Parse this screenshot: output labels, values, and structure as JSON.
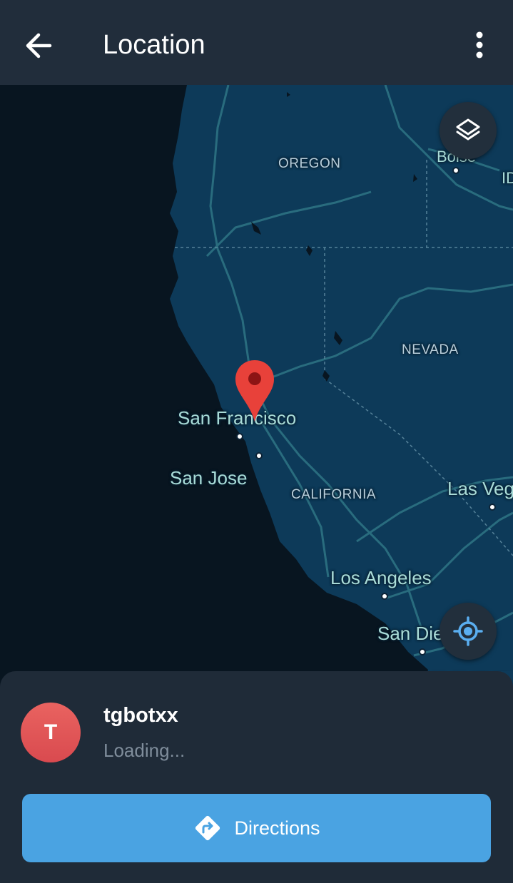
{
  "header": {
    "title": "Location",
    "back_icon": "arrow-left-icon",
    "menu_icon": "more-vertical-icon"
  },
  "map": {
    "theme_colors": {
      "ocean": "#081520",
      "land": "#0d3a59",
      "roads": "#2e7182",
      "pin": "#e8413a"
    },
    "labels": {
      "oregon": "OREGON",
      "boise": "Boise",
      "idaho": "ID",
      "nevada": "NEVADA",
      "san_francisco": "San Francisco",
      "san_jose": "San Jose",
      "california": "CALIFORNIA",
      "las_vegas": "Las Vegas",
      "los_angeles": "Los Angeles",
      "san_diego": "San Diego"
    },
    "layers_icon": "layers-icon",
    "my_location_icon": "my-location-icon",
    "pin_icon": "map-pin-icon"
  },
  "sheet": {
    "avatar_initial": "T",
    "name": "tgbotxx",
    "status": "Loading...",
    "directions_label": "Directions",
    "directions_icon": "directions-icon",
    "colors": {
      "avatar": "#e05656",
      "button": "#4aa3e2"
    }
  }
}
